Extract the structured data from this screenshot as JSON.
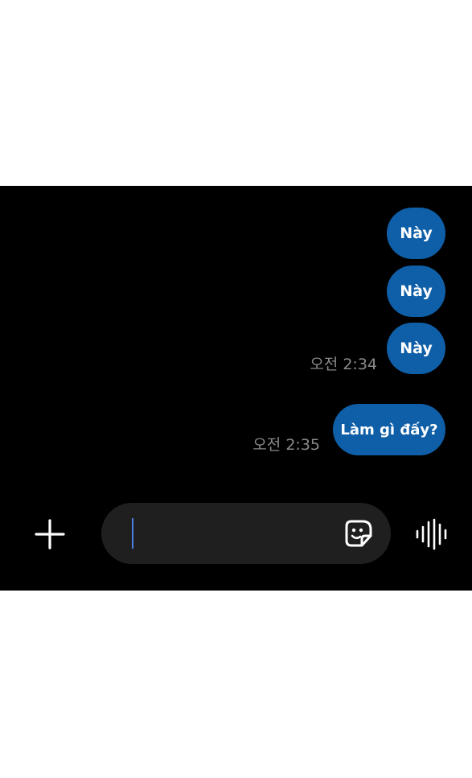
{
  "chat": {
    "messages": [
      {
        "text": "Này",
        "direction": "outgoing"
      },
      {
        "text": "Này",
        "direction": "outgoing"
      },
      {
        "text": "Này",
        "direction": "outgoing"
      },
      {
        "text": "Làm gì đấy?",
        "direction": "outgoing"
      }
    ],
    "timestamps": [
      "오전 2:34",
      "오전 2:35"
    ]
  },
  "composer": {
    "message_value": "",
    "attach_icon": "plus-icon",
    "sticker_icon": "sticker-smiley-icon",
    "voice_icon": "voice-waveform-icon"
  },
  "colors": {
    "background": "#000000",
    "bubble": "#0f5fa8",
    "timestamp": "#8a8a8a",
    "input_pill": "#1f1f1f",
    "caret": "#4a7fe0",
    "icon": "#ffffff"
  }
}
